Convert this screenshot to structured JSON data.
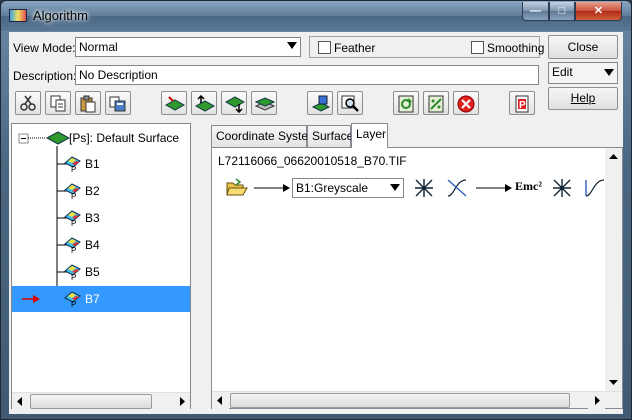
{
  "window": {
    "title": "Algorithm",
    "minimize": "—",
    "maximize": "□",
    "close": "✕"
  },
  "view_mode": {
    "label": "View Mode:",
    "value": "Normal"
  },
  "feather": {
    "label": "Feather",
    "checked": false
  },
  "smoothing": {
    "label": "Smoothing",
    "checked": false
  },
  "description": {
    "label": "Description:",
    "value": "No Description"
  },
  "buttons": {
    "close": "Close",
    "edit": "Edit",
    "help": "Help"
  },
  "tree": {
    "root": "[Ps]: Default Surface",
    "items": [
      "B1",
      "B2",
      "B3",
      "B4",
      "B5",
      "B7"
    ],
    "selected": "B7"
  },
  "tabs": [
    "Coordinate System",
    "Surface",
    "Layer"
  ],
  "active_tab": "Layer",
  "layer": {
    "filename": "L72116066_06620010518_B70.TIF",
    "band_select": "B1:Greyscale",
    "formula_icon_text": "Emc²"
  }
}
